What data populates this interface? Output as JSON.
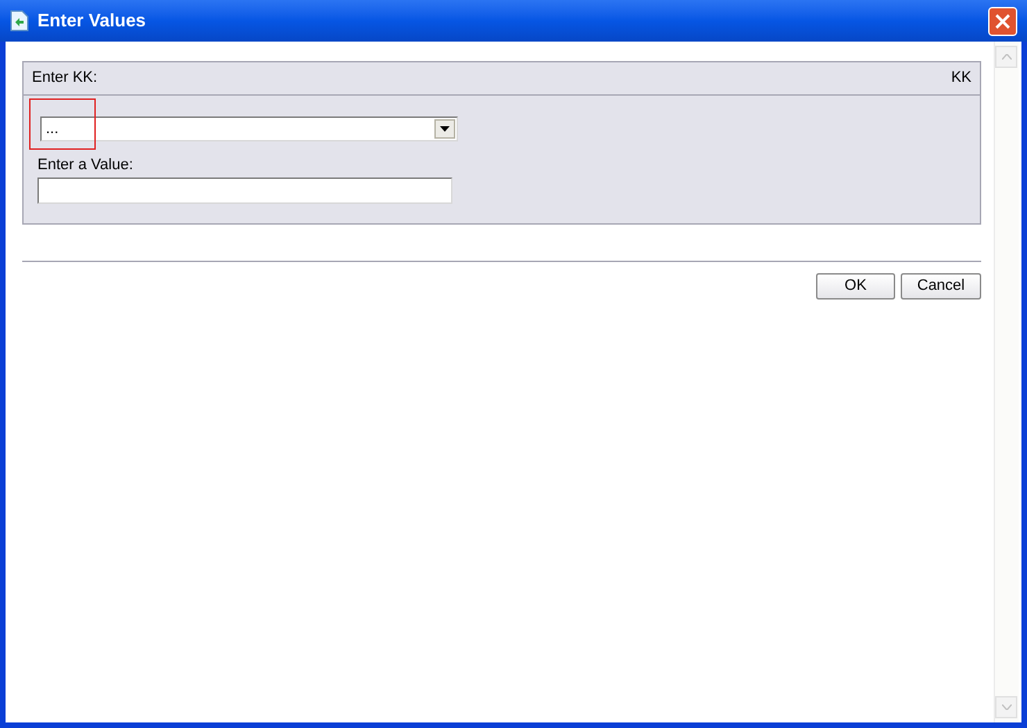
{
  "window": {
    "title": "Enter Values"
  },
  "panel": {
    "header_label": "Enter KK:",
    "header_right": "KK",
    "dropdown": {
      "value": "...",
      "highlighted": true
    },
    "value_field": {
      "label": "Enter a Value:"
    }
  },
  "buttons": [
    {
      "label": "OK",
      "kind": "ok"
    },
    {
      "label": "Cancel",
      "kind": "cancel"
    }
  ]
}
